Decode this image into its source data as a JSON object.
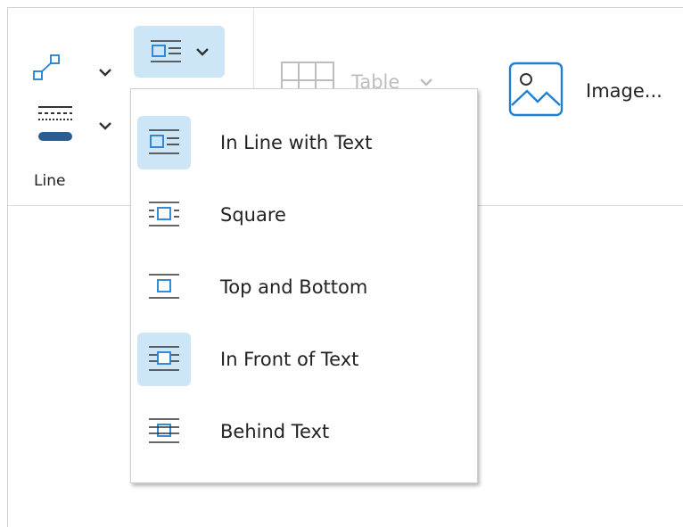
{
  "ribbon": {
    "line_group": {
      "label": "Line",
      "shape_icon": "line-arrow-icon",
      "style_icon": "line-style-icon",
      "wrap_icon": "text-wrap-inline-icon"
    },
    "table": {
      "label": "Table",
      "icon": "table-grid-icon",
      "enabled": false
    },
    "image": {
      "label": "Image...",
      "icon": "image-icon"
    }
  },
  "wrap_menu": {
    "items": [
      {
        "label": "In Line with Text",
        "icon": "wrap-inline-icon",
        "selected": true
      },
      {
        "label": "Square",
        "icon": "wrap-square-icon",
        "selected": false
      },
      {
        "label": "Top and Bottom",
        "icon": "wrap-top-bottom-icon",
        "selected": false
      },
      {
        "label": "In Front of Text",
        "icon": "wrap-in-front-icon",
        "selected": false
      },
      {
        "label": "Behind Text",
        "icon": "wrap-behind-icon",
        "selected": false
      }
    ]
  },
  "colors": {
    "accent_blue": "#1f7fd3",
    "active_bg": "#cde6f7",
    "disabled_text": "#bdbdbd"
  }
}
